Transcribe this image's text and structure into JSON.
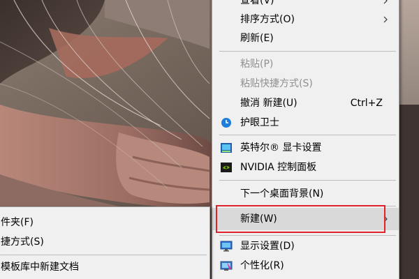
{
  "colors": {
    "menu_bg": "#f0f0f0",
    "menu_border": "#a0a0a0",
    "hover_bg": "#d9d9d9",
    "disabled_text": "#8f8f8f",
    "highlight_border": "#e0202a"
  },
  "context_menu": {
    "items": [
      {
        "label": "查看(V)",
        "icon": "",
        "submenu": true
      },
      {
        "label": "排序方式(O)",
        "icon": "",
        "submenu": true
      },
      {
        "label": "刷新(E)",
        "icon": ""
      },
      {
        "label": "粘贴(P)",
        "icon": "",
        "disabled": true
      },
      {
        "label": "粘贴快捷方式(S)",
        "icon": "",
        "disabled": true
      },
      {
        "label": "撤消 新建(U)",
        "shortcut": "Ctrl+Z",
        "icon": ""
      },
      {
        "label": "护眼卫士",
        "icon": "eye-care-clock-icon"
      },
      {
        "label": "英特尔® 显卡设置",
        "icon": "intel-graphics-icon"
      },
      {
        "label": "NVIDIA 控制面板",
        "icon": "nvidia-icon"
      },
      {
        "label": "下一个桌面背景(N)",
        "icon": ""
      },
      {
        "label": "新建(W)",
        "icon": "",
        "submenu": true,
        "highlighted": true
      },
      {
        "label": "显示设置(D)",
        "icon": "display-settings-icon"
      },
      {
        "label": "个性化(R)",
        "icon": "personalize-icon"
      }
    ]
  },
  "new_submenu": {
    "items": [
      {
        "label": "件夹(F)"
      },
      {
        "label": "捷方式(S)"
      },
      {
        "label": "模板库中新建文档"
      }
    ]
  }
}
